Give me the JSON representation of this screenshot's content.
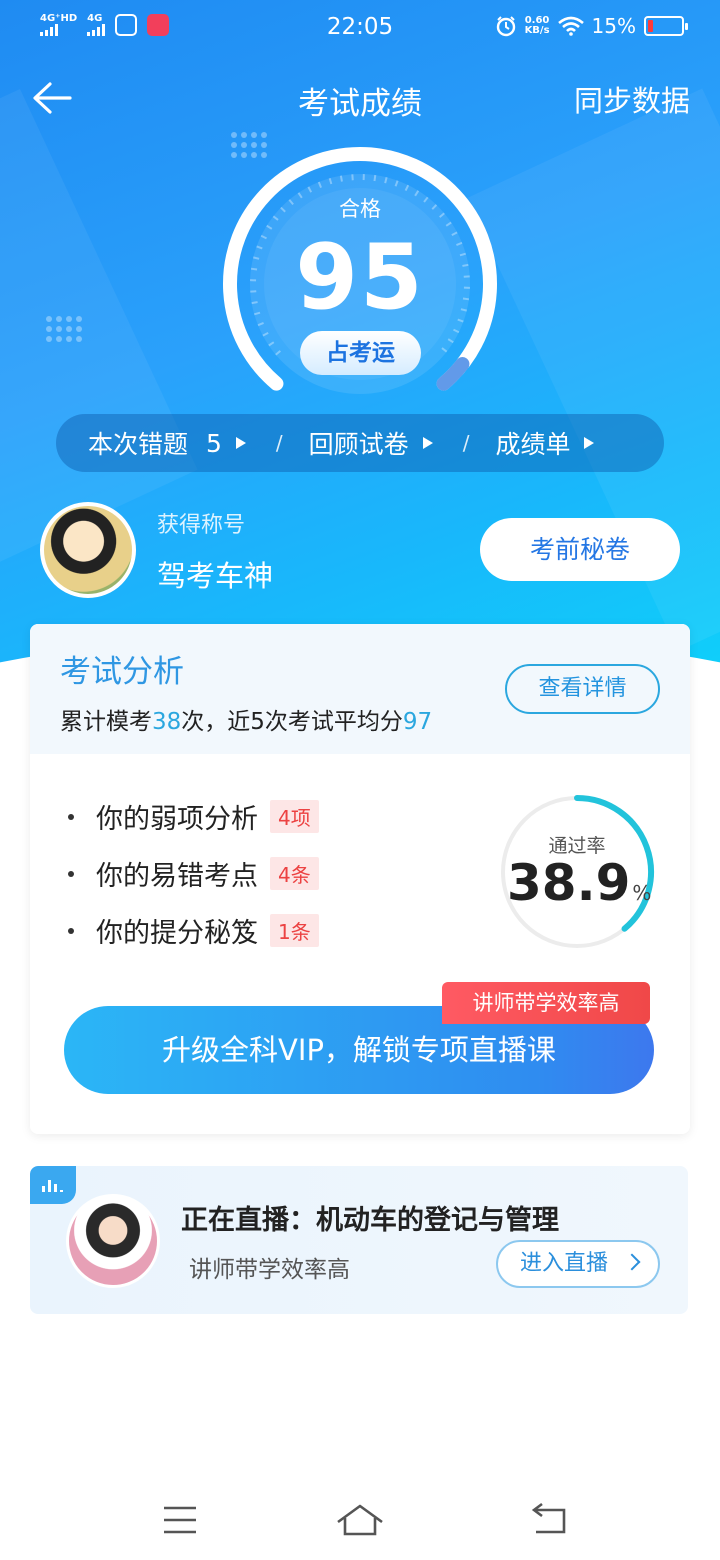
{
  "status_bar": {
    "network_1": "4G⁺HD",
    "network_2": "4G",
    "time": "22:05",
    "net_speed_value": "0.60",
    "net_speed_unit": "KB/s",
    "battery_percent": "15%",
    "battery_level": 0.15
  },
  "nav": {
    "title": "考试成绩",
    "sync_label": "同步数据"
  },
  "score": {
    "status": "合格",
    "value": "95",
    "fortune_button": "占考运"
  },
  "quick_links": {
    "wrong_label": "本次错题",
    "wrong_count": "5",
    "review_label": "回顾试卷",
    "report_label": "成绩单",
    "separator": "/"
  },
  "profile": {
    "title_label": "获得称号",
    "title_value": "驾考车神",
    "secret_button": "考前秘卷"
  },
  "analysis": {
    "title": "考试分析",
    "summary_prefix": "累计模考",
    "mock_count": "38",
    "summary_mid": "次，近5次考试平均分",
    "avg_score": "97",
    "detail_button": "查看详情",
    "items": [
      {
        "label": "你的弱项分析",
        "tag": "4项"
      },
      {
        "label": "你的易错考点",
        "tag": "4条"
      },
      {
        "label": "你的提分秘笈",
        "tag": "1条"
      }
    ],
    "pass_label": "通过率",
    "pass_value": "38.9",
    "pass_unit": "%",
    "pass_fraction": 0.389,
    "vip_button": "升级全科VIP，解锁专项直播课",
    "vip_tag": "讲师带学效率高"
  },
  "live": {
    "title": "正在直播：机动车的登记与管理",
    "subtitle": "讲师带学效率高",
    "enter_button": "进入直播"
  },
  "icons": {
    "back": "back-arrow-icon",
    "menu": "menu-icon",
    "home": "home-icon",
    "return": "return-icon",
    "live": "live-bars-icon"
  },
  "colors": {
    "primary": "#2494df",
    "accent_cyan": "#22c3db",
    "warning_red": "#ec4242"
  }
}
